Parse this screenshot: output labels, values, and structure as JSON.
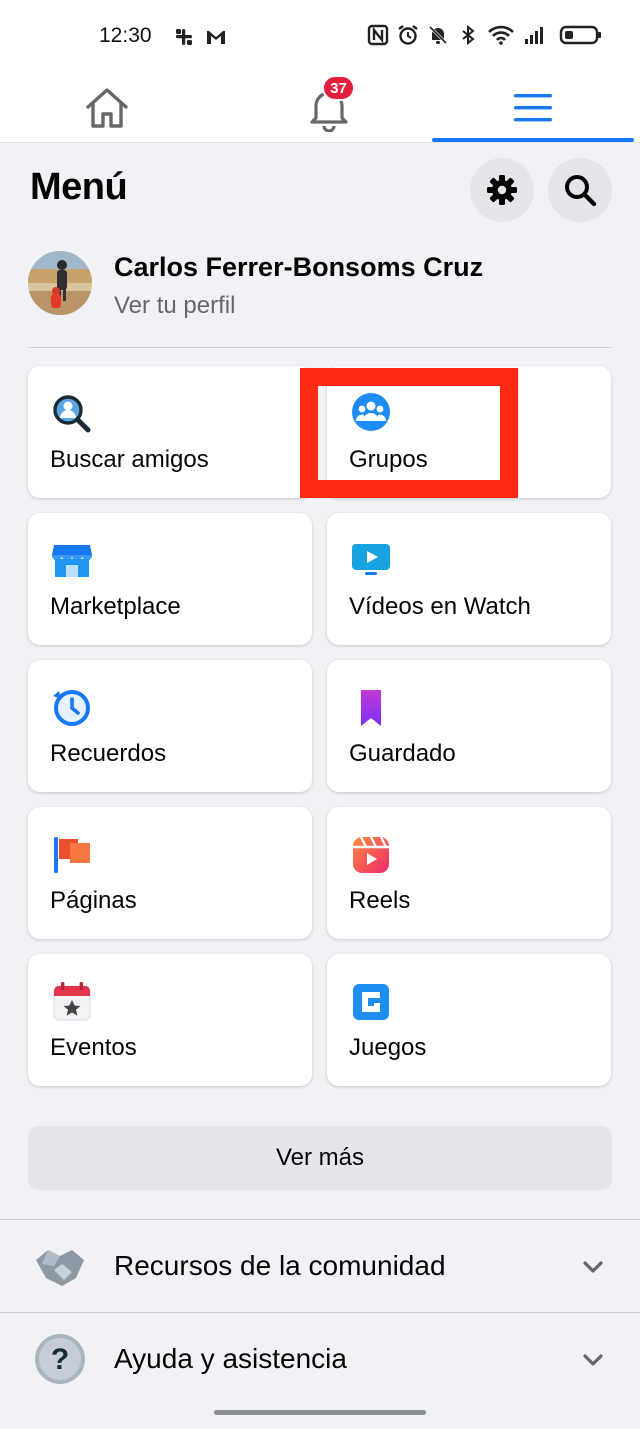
{
  "status_bar": {
    "time": "12:30"
  },
  "nav": {
    "notification_count": "37",
    "accent_color": "#1877f2",
    "badge_color": "#e41e3f"
  },
  "header": {
    "title": "Menú"
  },
  "profile": {
    "name": "Carlos Ferrer-Bonsoms Cruz",
    "subtitle": "Ver tu perfil"
  },
  "shortcuts": [
    {
      "label": "Buscar amigos",
      "icon": "find-friends-icon"
    },
    {
      "label": "Grupos",
      "icon": "groups-icon"
    },
    {
      "label": "Marketplace",
      "icon": "marketplace-icon"
    },
    {
      "label": "Vídeos en Watch",
      "icon": "watch-icon"
    },
    {
      "label": "Recuerdos",
      "icon": "memories-icon"
    },
    {
      "label": "Guardado",
      "icon": "saved-icon"
    },
    {
      "label": "Páginas",
      "icon": "pages-icon"
    },
    {
      "label": "Reels",
      "icon": "reels-icon"
    },
    {
      "label": "Eventos",
      "icon": "events-icon"
    },
    {
      "label": "Juegos",
      "icon": "games-icon"
    }
  ],
  "see_more": {
    "label": "Ver más"
  },
  "sections": [
    {
      "label": "Recursos de la comunidad",
      "icon": "handshake-icon"
    },
    {
      "label": "Ayuda y asistencia",
      "icon": "help-icon"
    }
  ],
  "highlight_color": "#ff2a12"
}
